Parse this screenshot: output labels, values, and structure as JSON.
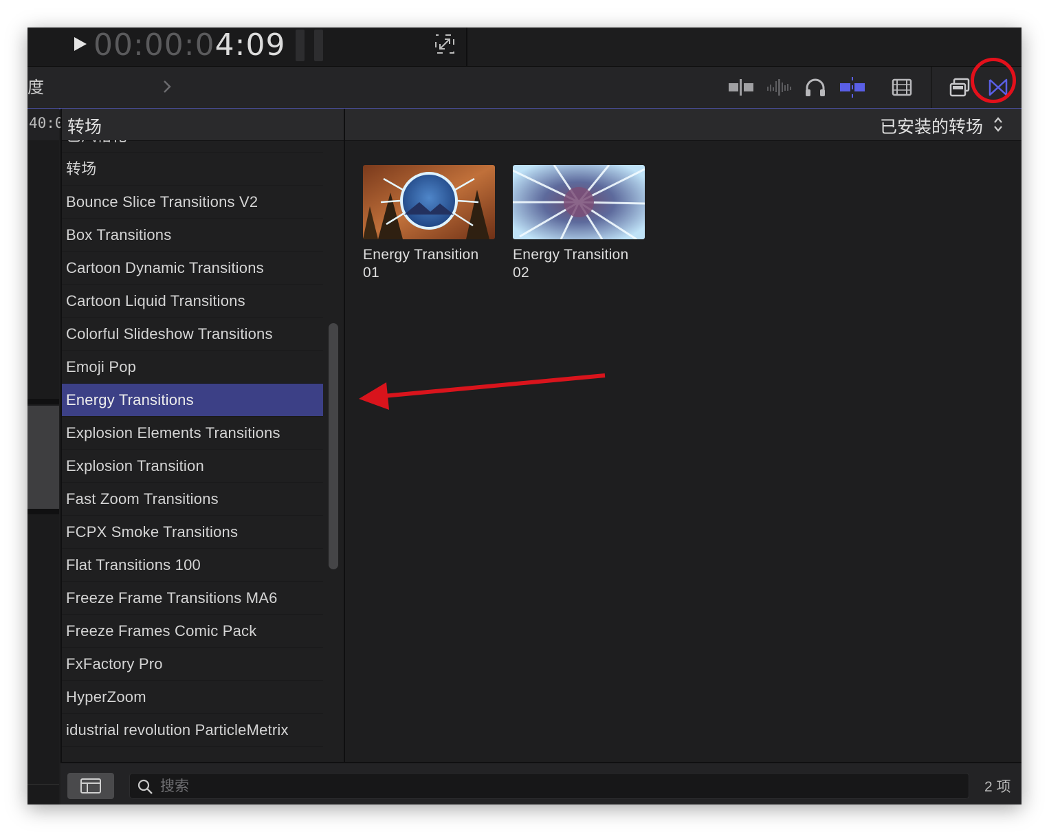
{
  "viewer": {
    "timecode_dim": "00:00:0",
    "timecode_lit": "4:09"
  },
  "toolbar": {
    "left_label": "度",
    "active_color": "#5a5fe6",
    "highlight_color": "#e3101b",
    "icons": [
      "clip-skimming-icon",
      "audio-skimming-icon",
      "headphones-icon",
      "snapping-icon",
      "effects-browser-icon",
      "photos-audio-browser-icon",
      "transitions-browser-icon"
    ]
  },
  "timeline": {
    "ruler_text": "40:0"
  },
  "sidebar": {
    "header": "转场",
    "items": [
      {
        "label": "已风格化"
      },
      {
        "label": "转场"
      },
      {
        "label": "Bounce Slice Transitions V2"
      },
      {
        "label": "Box Transitions"
      },
      {
        "label": "Cartoon Dynamic Transitions"
      },
      {
        "label": "Cartoon Liquid Transitions"
      },
      {
        "label": "Colorful Slideshow Transitions"
      },
      {
        "label": "Emoji Pop"
      },
      {
        "label": "Energy Transitions",
        "selected": true
      },
      {
        "label": "Explosion Elements Transitions"
      },
      {
        "label": "Explosion Transition"
      },
      {
        "label": "Fast Zoom Transitions"
      },
      {
        "label": "FCPX Smoke Transitions"
      },
      {
        "label": "Flat Transitions 100"
      },
      {
        "label": "Freeze Frame Transitions MA6"
      },
      {
        "label": "Freeze Frames Comic Pack"
      },
      {
        "label": "FxFactory Pro"
      },
      {
        "label": "HyperZoom"
      },
      {
        "label": "idustrial revolution ParticleMetrix"
      }
    ]
  },
  "content": {
    "filter_label": "已安装的转场",
    "thumbnails": [
      {
        "line1": "Energy Transition",
        "line2": "01"
      },
      {
        "line1": "Energy Transition",
        "line2": "02"
      }
    ]
  },
  "bottom": {
    "search_placeholder": "搜索",
    "item_count": "2 项"
  },
  "annotation": {
    "arrow_color": "#d9141c"
  }
}
